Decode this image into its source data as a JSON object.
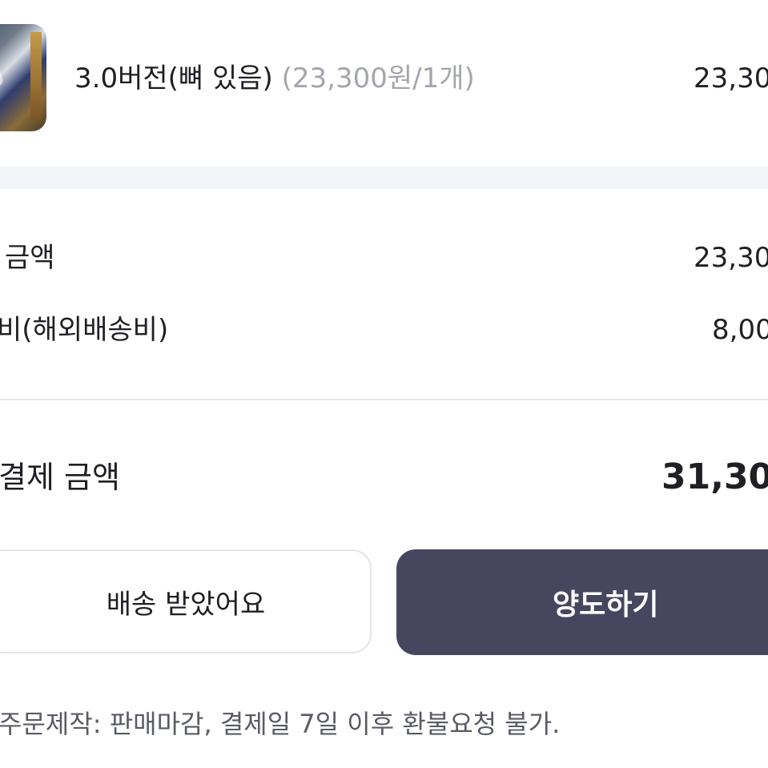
{
  "product": {
    "name": "3.0버전(뼈 있음)",
    "unit_price": "(23,300원/1개)",
    "price": "23,30"
  },
  "summary": {
    "product_amount_label": "금액",
    "product_amount_value": "23,30",
    "shipping_label": "비(해외배송비)",
    "shipping_value": "8,00",
    "total_label": "결제 금액",
    "total_value": "31,30"
  },
  "actions": {
    "received_label": "배송 받았어요",
    "transfer_label": "양도하기"
  },
  "notice": "주문제작: 판매마감, 결제일 7일 이후 환불요청 불가."
}
